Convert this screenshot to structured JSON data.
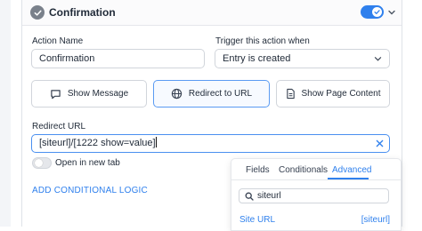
{
  "header": {
    "title": "Confirmation"
  },
  "form": {
    "action_name_label": "Action Name",
    "action_name_value": "Confirmation",
    "trigger_label": "Trigger this action when",
    "trigger_value": "Entry is created"
  },
  "actions": [
    {
      "label": "Show Message",
      "icon": "message-icon"
    },
    {
      "label": "Redirect to URL",
      "icon": "globe-icon",
      "active": true
    },
    {
      "label": "Show Page Content",
      "icon": "document-icon"
    }
  ],
  "redirect": {
    "label": "Redirect URL",
    "value": "[siteurl]/[1222 show=value]",
    "open_new_tab_label": "Open in new tab"
  },
  "conditional_link": "ADD CONDITIONAL LOGIC",
  "popover": {
    "tabs": [
      "Fields",
      "Conditionals",
      "Advanced"
    ],
    "active_tab": "Advanced",
    "search_value": "siteurl",
    "result": {
      "name": "Site URL",
      "tag": "[siteurl]"
    }
  },
  "colors": {
    "accent": "#2f80ed",
    "border": "#d1d5db"
  }
}
